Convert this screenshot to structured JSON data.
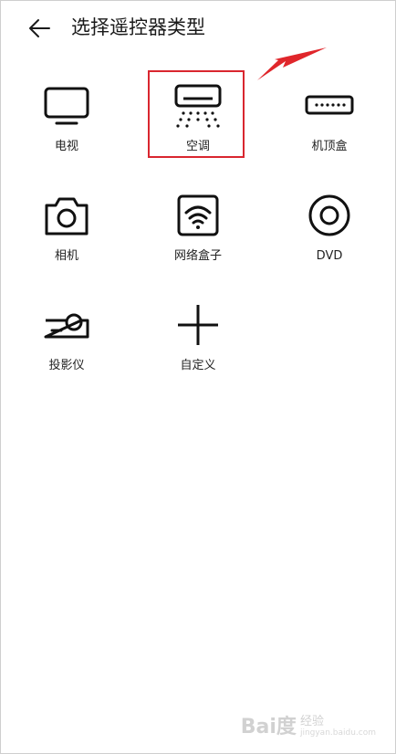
{
  "header": {
    "title": "选择遥控器类型",
    "back_icon": "arrow-left-icon"
  },
  "devices": [
    {
      "label": "电视",
      "icon": "tv-icon"
    },
    {
      "label": "空调",
      "icon": "air-conditioner-icon"
    },
    {
      "label": "机顶盒",
      "icon": "set-top-box-icon"
    },
    {
      "label": "相机",
      "icon": "camera-icon"
    },
    {
      "label": "网络盒子",
      "icon": "network-box-icon"
    },
    {
      "label": "DVD",
      "icon": "dvd-icon"
    },
    {
      "label": "投影仪",
      "icon": "projector-icon"
    },
    {
      "label": "自定义",
      "icon": "plus-icon"
    }
  ],
  "annotation": {
    "highlight_color": "#d9262f",
    "arrow_color": "#e0262b"
  },
  "watermark": {
    "brand": "Bai度",
    "sub": "经验",
    "url": "jingyan.baidu.com"
  }
}
